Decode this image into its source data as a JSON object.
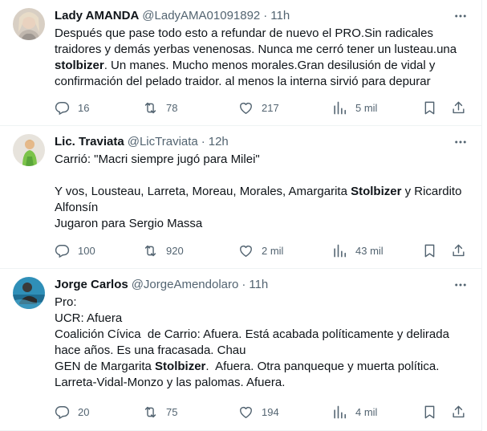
{
  "tweets": [
    {
      "name": "Lady AMANDA",
      "handle": "@LadyAMA01091892",
      "time": "11h",
      "text_parts": [
        "Después que pase todo esto a refundar de nuevo el PRO.Sin radicales traidores y demás yerbas venenosas. Nunca me cerró tener un lusteau.una ",
        "stolbizer",
        ". Un manes. Mucho menos morales.Gran desilusión de vidal y confirmación del pelado traidor. al menos la interna sirvió para depurar"
      ],
      "replies": "16",
      "retweets": "78",
      "likes": "217",
      "views": "5 mil"
    },
    {
      "name": "Lic. Traviata",
      "handle": "@LicTraviata",
      "time": "12h",
      "text_parts": [
        "Carrió: \"Macri siempre jugó para Milei\"\n\nY vos, Lousteau, Larreta, Moreau, Morales, Amargarita ",
        "Stolbizer",
        " y Ricardito Alfonsín\nJugaron para Sergio Massa"
      ],
      "replies": "100",
      "retweets": "920",
      "likes": "2 mil",
      "views": "43 mil"
    },
    {
      "name": "Jorge Carlos",
      "handle": "@JorgeAmendolaro",
      "time": "11h",
      "text_parts": [
        "Pro:\nUCR: Afuera\nCoalición Cívica  de Carrio: Afuera. Está acabada políticamente y delirada hace años. Es una fracasada. Chau\nGEN de Margarita ",
        "Stolbizer",
        ".  Afuera. Otra panqueque y muerta política.\nLarreta-Vidal-Monzo y las palomas. Afuera."
      ],
      "replies": "20",
      "retweets": "75",
      "likes": "194",
      "views": "4 mil"
    }
  ],
  "icons": {
    "reply": "reply-icon",
    "retweet": "retweet-icon",
    "like": "heart-icon",
    "views": "views-icon",
    "bookmark": "bookmark-icon",
    "share": "share-icon",
    "more": "more-icon"
  },
  "colors": {
    "text": "#0f1419",
    "secondary": "#536471",
    "border": "#eff3f4"
  }
}
